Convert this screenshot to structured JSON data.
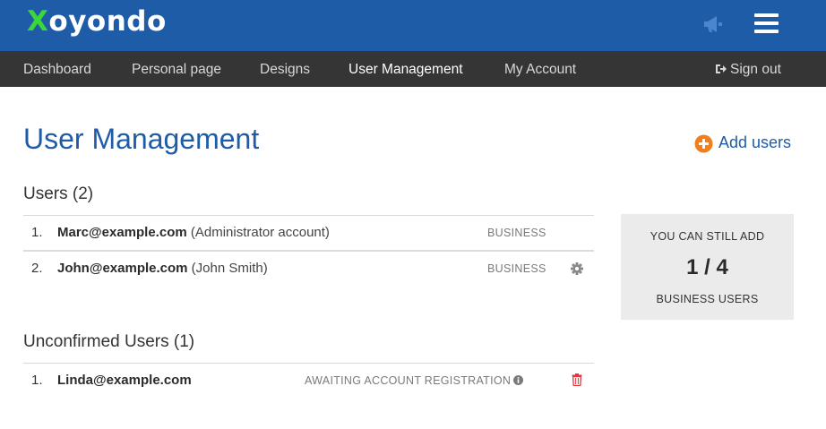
{
  "brand": {
    "logo_first": "X",
    "logo_rest": "oyondo",
    "logo_accent": "#3ad63a",
    "header_color": "#1f5ca8"
  },
  "header": {
    "icons": [
      "megaphone-icon",
      "hamburger-menu-icon"
    ]
  },
  "nav": {
    "items": [
      {
        "label": "Dashboard",
        "active": false
      },
      {
        "label": "Personal page",
        "active": false
      },
      {
        "label": "Designs",
        "active": false
      },
      {
        "label": "User Management",
        "active": true
      },
      {
        "label": "My Account",
        "active": false
      }
    ],
    "signout_label": "Sign out",
    "signout_icon": "sign-out-icon"
  },
  "page": {
    "title": "User Management",
    "add_users_label": "Add users",
    "add_users_icon": "plus-circle-icon",
    "add_users_color": "#f07f22"
  },
  "users": {
    "heading": "Users (2)",
    "rows": [
      {
        "num": "1.",
        "email": "Marc@example.com",
        "note": " (Administrator account)",
        "plan": "BUSINESS",
        "action_icon": ""
      },
      {
        "num": "2.",
        "email": "John@example.com",
        "note": " (John Smith)",
        "plan": "BUSINESS",
        "action_icon": "gear-icon"
      }
    ]
  },
  "unconfirmed": {
    "heading": "Unconfirmed Users (1)",
    "rows": [
      {
        "num": "1.",
        "email": "Linda@example.com",
        "status": "AWAITING ACCOUNT REGISTRATION",
        "status_icon": "info-icon",
        "action_icon": "trash-icon",
        "action_color": "#e0383e"
      }
    ]
  },
  "quota": {
    "line1": "YOU CAN STILL ADD",
    "count": "1 / 4",
    "line3": "BUSINESS USERS"
  }
}
